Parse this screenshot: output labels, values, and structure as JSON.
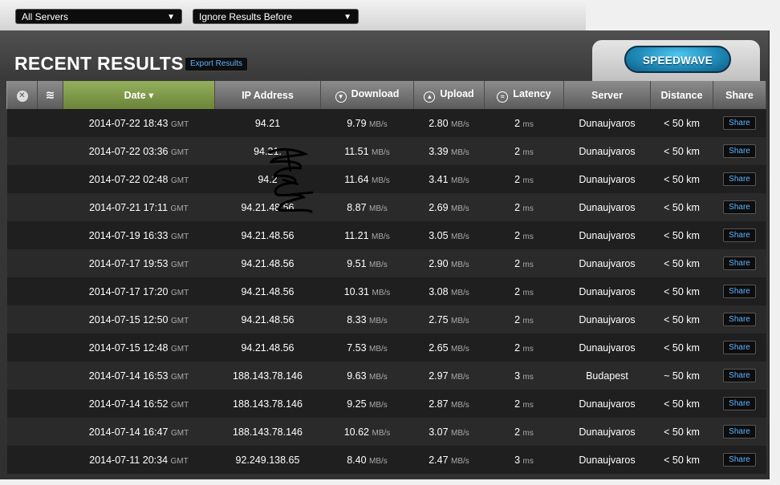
{
  "filters": {
    "server_select": "All Servers",
    "ignore_select": "Ignore Results Before"
  },
  "panel": {
    "title": "RECENT RESULTS",
    "export_label": "Export Results",
    "speedwave_label": "SPEEDWAVE"
  },
  "table": {
    "headers": {
      "date": "Date ▾",
      "ip": "IP Address",
      "download": "Download",
      "upload": "Upload",
      "latency": "Latency",
      "server": "Server",
      "distance": "Distance",
      "share": "Share"
    },
    "units": {
      "tz": "GMT",
      "speed": "MB/s",
      "latency": "ms"
    },
    "rows": [
      {
        "date": "2014-07-22 18:43",
        "ip": "94.21",
        "down": "9.79",
        "up": "2.80",
        "lat": "2",
        "server": "Dunaujvaros",
        "dist": "< 50 km",
        "share": "Share"
      },
      {
        "date": "2014-07-22 03:36",
        "ip": "94.21.",
        "down": "11.51",
        "up": "3.39",
        "lat": "2",
        "server": "Dunaujvaros",
        "dist": "< 50 km",
        "share": "Share"
      },
      {
        "date": "2014-07-22 02:48",
        "ip": "94.2",
        "down": "11.64",
        "up": "3.41",
        "lat": "2",
        "server": "Dunaujvaros",
        "dist": "< 50 km",
        "share": "Share"
      },
      {
        "date": "2014-07-21 17:11",
        "ip": "94.21.48.56",
        "down": "8.87",
        "up": "2.69",
        "lat": "2",
        "server": "Dunaujvaros",
        "dist": "< 50 km",
        "share": "Share"
      },
      {
        "date": "2014-07-19 16:33",
        "ip": "94.21.48.56",
        "down": "11.21",
        "up": "3.05",
        "lat": "2",
        "server": "Dunaujvaros",
        "dist": "< 50 km",
        "share": "Share"
      },
      {
        "date": "2014-07-17 19:53",
        "ip": "94.21.48.56",
        "down": "9.51",
        "up": "2.90",
        "lat": "2",
        "server": "Dunaujvaros",
        "dist": "< 50 km",
        "share": "Share"
      },
      {
        "date": "2014-07-17 17:20",
        "ip": "94.21.48.56",
        "down": "10.31",
        "up": "3.08",
        "lat": "2",
        "server": "Dunaujvaros",
        "dist": "< 50 km",
        "share": "Share"
      },
      {
        "date": "2014-07-15 12:50",
        "ip": "94.21.48.56",
        "down": "8.33",
        "up": "2.75",
        "lat": "2",
        "server": "Dunaujvaros",
        "dist": "< 50 km",
        "share": "Share"
      },
      {
        "date": "2014-07-15 12:48",
        "ip": "94.21.48.56",
        "down": "7.53",
        "up": "2.65",
        "lat": "2",
        "server": "Dunaujvaros",
        "dist": "< 50 km",
        "share": "Share"
      },
      {
        "date": "2014-07-14 16:53",
        "ip": "188.143.78.146",
        "down": "9.63",
        "up": "2.97",
        "lat": "3",
        "server": "Budapest",
        "dist": "~ 50 km",
        "share": "Share"
      },
      {
        "date": "2014-07-14 16:52",
        "ip": "188.143.78.146",
        "down": "9.25",
        "up": "2.87",
        "lat": "2",
        "server": "Dunaujvaros",
        "dist": "< 50 km",
        "share": "Share"
      },
      {
        "date": "2014-07-14 16:47",
        "ip": "188.143.78.146",
        "down": "10.62",
        "up": "3.07",
        "lat": "2",
        "server": "Dunaujvaros",
        "dist": "< 50 km",
        "share": "Share"
      },
      {
        "date": "2014-07-11 20:34",
        "ip": "92.249.138.65",
        "down": "8.40",
        "up": "2.47",
        "lat": "3",
        "server": "Dunaujvaros",
        "dist": "< 50 km",
        "share": "Share"
      }
    ]
  },
  "colors": {
    "accent_link": "#5ab4ff",
    "date_header": "#7f9a48",
    "speedwave": "#1f8ab8"
  },
  "icons": [
    "close-icon",
    "wave-icon",
    "download-icon",
    "upload-icon",
    "latency-icon",
    "dropdown-arrow-icon"
  ]
}
